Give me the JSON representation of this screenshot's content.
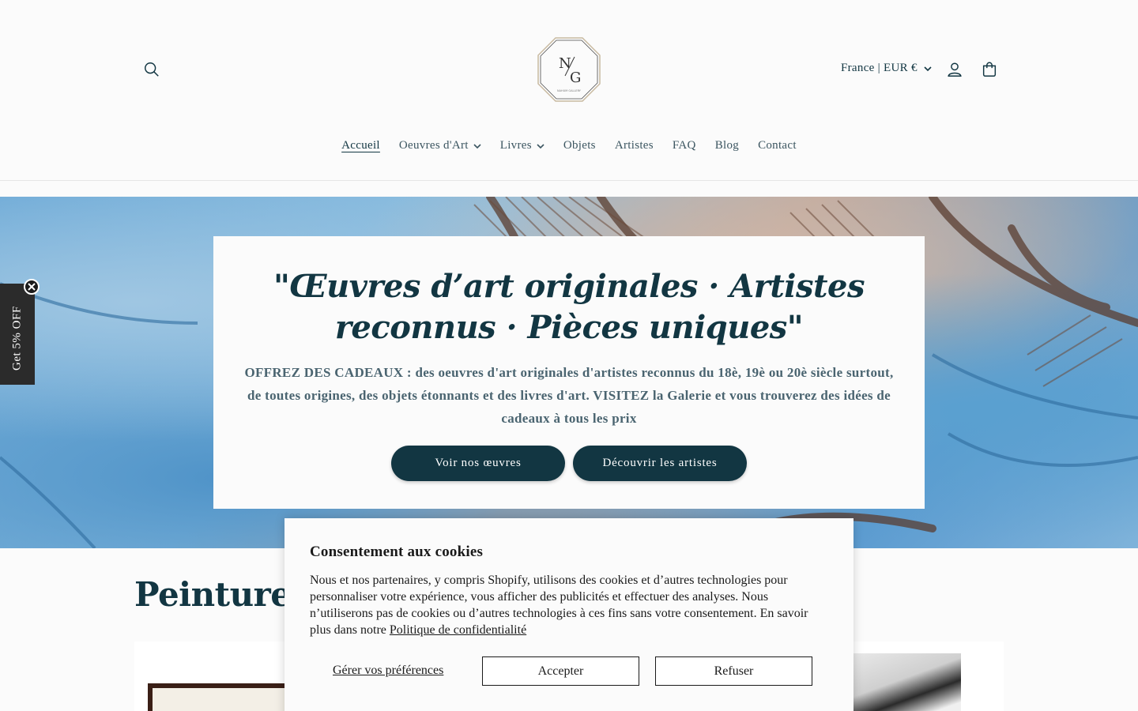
{
  "header": {
    "logo_text": "N/G",
    "logo_subtext": "NAHUM GALLERY",
    "locale": "France | EUR €",
    "icons": {
      "search": "search-icon",
      "account": "user-icon",
      "cart": "bag-icon"
    }
  },
  "nav": {
    "items": [
      {
        "label": "Accueil",
        "active": true,
        "dropdown": false
      },
      {
        "label": "Oeuvres d'Art",
        "active": false,
        "dropdown": true
      },
      {
        "label": "Livres",
        "active": false,
        "dropdown": true
      },
      {
        "label": "Objets",
        "active": false,
        "dropdown": false
      },
      {
        "label": "Artistes",
        "active": false,
        "dropdown": false
      },
      {
        "label": "FAQ",
        "active": false,
        "dropdown": false
      },
      {
        "label": "Blog",
        "active": false,
        "dropdown": false
      },
      {
        "label": "Contact",
        "active": false,
        "dropdown": false
      }
    ]
  },
  "hero": {
    "title": "\"Œuvres d’art originales · Artistes reconnus · Pièces uniques\"",
    "text": "OFFREZ DES CADEAUX : des oeuvres d'art originales d'artistes reconnus du 18è, 19è ou 20è siècle surtout, de toutes origines, des objets étonnants et des livres d'art. VISITEZ la Galerie et vous trouverez des idées de cadeaux à tous les prix",
    "button_primary": "Voir nos œuvres",
    "button_secondary": "Découvrir les artistes"
  },
  "side_tab": {
    "label": "Get 5% OFF"
  },
  "section": {
    "title": "Peintures"
  },
  "cookie": {
    "title": "Consentement aux cookies",
    "body": "Nous et nos partenaires, y compris Shopify, utilisons des cookies et d’autres technologies pour personnaliser votre expérience, vous afficher des publicités et effectuer des analyses. Nous n’utiliserons pas de cookies ou d’autres technologies à ces fins sans votre consentement. En savoir plus dans notre ",
    "link": "Politique de confidentialité",
    "manage": "Gérer vos préférences",
    "accept": "Accepter",
    "refuse": "Refuser"
  },
  "colors": {
    "primary": "#123642",
    "background": "#fbfbfb",
    "muted_text": "#4a6470"
  }
}
